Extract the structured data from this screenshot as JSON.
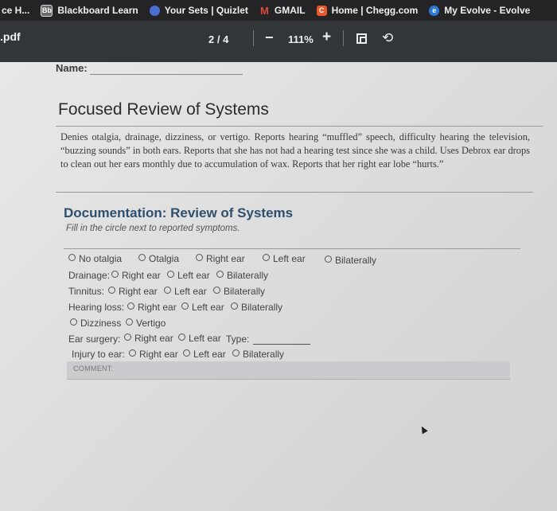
{
  "bookmarks": [
    {
      "label": "ce H...",
      "icon": "page-icon",
      "color": ""
    },
    {
      "label": "Blackboard Learn",
      "icon": "blackboard-icon",
      "icon_text": "Bb",
      "color": "#6a6a6a"
    },
    {
      "label": "Your Sets | Quizlet",
      "icon": "quizlet-icon",
      "color": "#4a6fd0"
    },
    {
      "label": "GMAIL",
      "icon": "gmail-icon",
      "icon_text": "M",
      "color": ""
    },
    {
      "label": "Home | Chegg.com",
      "icon": "chegg-icon",
      "icon_text": "C",
      "color": "#e8582b"
    },
    {
      "label": "My Evolve - Evolve",
      "icon": "evolve-icon",
      "icon_text": "e",
      "color": "#2b7bd6"
    }
  ],
  "pdf_toolbar": {
    "filename": ".pdf",
    "page_indicator": "2 / 4",
    "zoom_out": "−",
    "zoom_level": "111%",
    "zoom_in": "+"
  },
  "form": {
    "name_label": "Name:",
    "section_title": "Focused Review of Systems",
    "paragraph": "Denies otalgia, drainage, dizziness, or vertigo. Reports hearing “muffled” speech, difficulty hearing the television, “buzzing sounds” in both ears. Reports that she has not had a hearing test since she was a child. Uses Debrox ear drops to clean out her ears monthly due to accumulation of wax. Reports that her right ear lobe “hurts.”",
    "doc_title": "Documentation: Review of Systems",
    "doc_subtitle": "Fill in the circle next to reported symptoms.",
    "row1": [
      "No otalgia",
      "Otalgia",
      "Right ear",
      "Left ear",
      "Bilaterally"
    ],
    "drainage": {
      "label": "Drainage:",
      "options": [
        "Right ear",
        "Left ear",
        "Bilaterally"
      ]
    },
    "tinnitus": {
      "label": "Tinnitus:",
      "options": [
        "Right ear",
        "Left ear",
        "Bilaterally"
      ]
    },
    "hearing_loss": {
      "label": "Hearing loss:",
      "options": [
        "Right ear",
        "Left ear",
        "Bilaterally"
      ]
    },
    "dizziness_row": [
      "Dizziness",
      "Vertigo"
    ],
    "ear_surgery": {
      "label": "Ear surgery:",
      "options": [
        "Right ear",
        "Left ear"
      ],
      "type_label": "Type:"
    },
    "injury": {
      "label": "Injury to ear:",
      "options": [
        "Right ear",
        "Left ear",
        "Bilaterally"
      ]
    },
    "comment_label": "COMMENT:"
  }
}
